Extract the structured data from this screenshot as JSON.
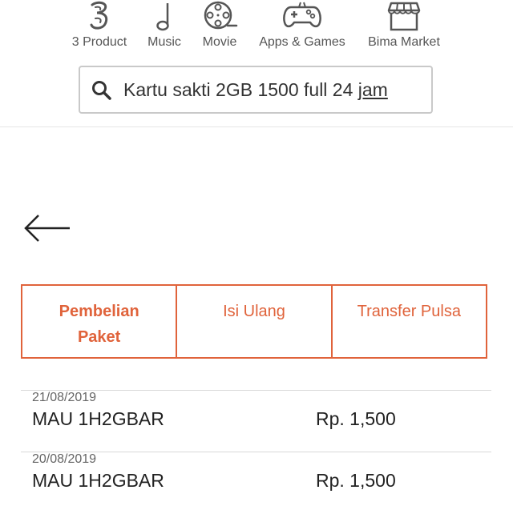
{
  "nav": {
    "items": [
      {
        "label": "3 Product",
        "icon": "three-logo-icon"
      },
      {
        "label": "Music",
        "icon": "music-note-icon"
      },
      {
        "label": "Movie",
        "icon": "film-reel-icon"
      },
      {
        "label": "Apps & Games",
        "icon": "gamepad-icon"
      },
      {
        "label": "Bima Market",
        "icon": "store-icon"
      }
    ]
  },
  "search": {
    "text_main": "Kartu sakti 2GB 1500 full 24 ",
    "text_underlined": "jam",
    "icon": "search-icon"
  },
  "back": {
    "icon": "back-arrow-icon"
  },
  "tabs": [
    {
      "label": "Pembelian Paket",
      "active": true
    },
    {
      "label": "Isi Ulang",
      "active": false
    },
    {
      "label": "Transfer Pulsa",
      "active": false
    }
  ],
  "transactions": [
    {
      "date": "21/08/2019",
      "name": "MAU 1H2GBAR",
      "amount": "Rp. 1,500"
    },
    {
      "date": "20/08/2019",
      "name": "MAU 1H2GBAR",
      "amount": "Rp. 1,500"
    }
  ],
  "colors": {
    "accent": "#e0633b",
    "icon": "#555555",
    "border": "#c9c9c9"
  }
}
